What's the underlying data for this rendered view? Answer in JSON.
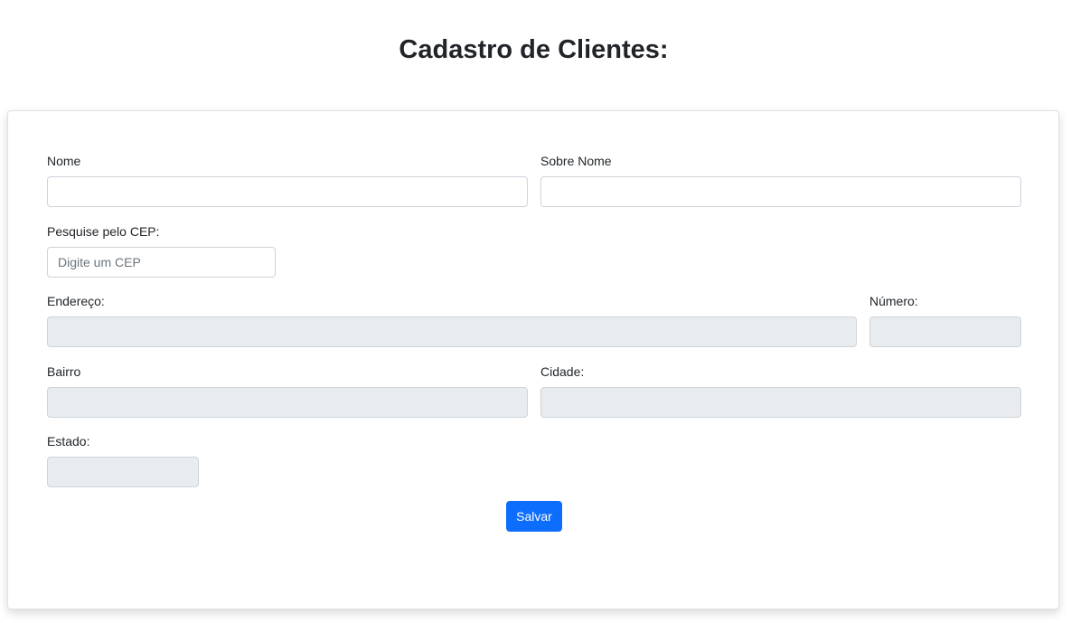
{
  "page": {
    "title": "Cadastro de Clientes:"
  },
  "form": {
    "nome": {
      "label": "Nome",
      "value": "",
      "placeholder": ""
    },
    "sobre_nome": {
      "label": "Sobre Nome",
      "value": "",
      "placeholder": ""
    },
    "cep": {
      "label": "Pesquise pelo CEP:",
      "value": "",
      "placeholder": "Digite um CEP"
    },
    "endereco": {
      "label": "Endereço:",
      "value": ""
    },
    "numero": {
      "label": "Número:",
      "value": ""
    },
    "bairro": {
      "label": "Bairro",
      "value": ""
    },
    "cidade": {
      "label": "Cidade:",
      "value": ""
    },
    "estado": {
      "label": "Estado:",
      "value": ""
    },
    "save_label": "Salvar"
  },
  "colors": {
    "primary": "#0d6efd",
    "readonly_background": "#e9ecef",
    "input_border": "#ced4da",
    "text": "#212529"
  }
}
